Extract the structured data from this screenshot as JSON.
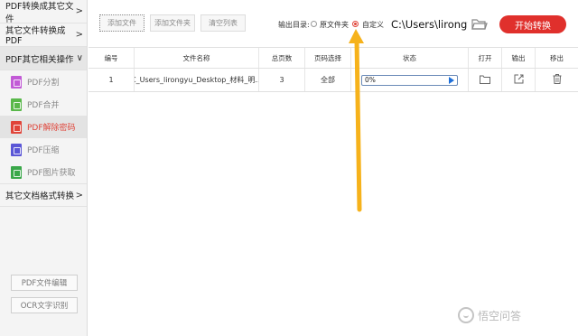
{
  "sidebar": {
    "sections": [
      {
        "label": "PDF转换成其它文件",
        "chevron": ">"
      },
      {
        "label": "其它文件转换成PDF",
        "chevron": ">"
      },
      {
        "label": "PDF其它相关操作",
        "chevron": "v"
      }
    ],
    "items": [
      {
        "label": "PDF分割",
        "icon": "pdf-split-icon",
        "color": "#c25ad6"
      },
      {
        "label": "PDF合并",
        "icon": "pdf-merge-icon",
        "color": "#59b84a"
      },
      {
        "label": "PDF解除密码",
        "icon": "pdf-unlock-icon",
        "color": "#e0453a"
      },
      {
        "label": "PDF压缩",
        "icon": "pdf-compress-icon",
        "color": "#5a56d6"
      },
      {
        "label": "PDF图片获取",
        "icon": "pdf-image-icon",
        "color": "#3aa84a"
      }
    ],
    "other_section": {
      "label": "其它文档格式转换",
      "chevron": ">"
    },
    "bottom_buttons": [
      "PDF文件编辑",
      "OCR文字识别"
    ]
  },
  "toolbar": {
    "add_file": "添加文件",
    "add_folder": "添加文件夹",
    "clear_list": "清空列表",
    "output_dir_label": "输出目录:",
    "option_original": "原文件夹",
    "option_custom": "自定义",
    "output_path": "C:\\Users\\lirongyu",
    "start_button": "开始转换"
  },
  "table": {
    "headers": [
      "编号",
      "文件名称",
      "总页数",
      "页码选择",
      "状态",
      "打开",
      "输出",
      "移出"
    ],
    "rows": [
      {
        "index": "1",
        "filename": "C_Users_lirongyu_Desktop_材料_明...",
        "pages": "3",
        "page_select": "全部",
        "status": "0%"
      }
    ]
  },
  "watermark": {
    "text": "悟空问答"
  },
  "colors": {
    "accent": "#e0302c",
    "arrow": "#f6b21b",
    "selected": "#e0453a"
  }
}
